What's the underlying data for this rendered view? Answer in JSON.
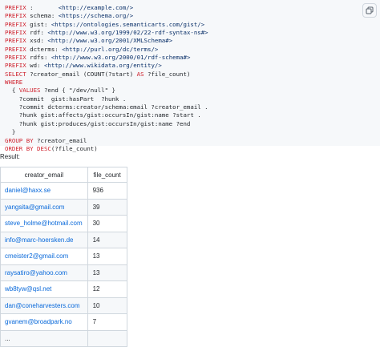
{
  "query": {
    "prefixes": [
      {
        "kw": "PREFIX",
        "name": " :       ",
        "iri": "<http://example.com/>"
      },
      {
        "kw": "PREFIX",
        "name": " schema: ",
        "iri": "<https://schema.org/>"
      },
      {
        "kw": "PREFIX",
        "name": " gist: ",
        "iri": "<https://ontologies.semanticarts.com/gist/>"
      },
      {
        "kw": "PREFIX",
        "name": " rdf: ",
        "iri": "<http://www.w3.org/1999/02/22-rdf-syntax-ns#>"
      },
      {
        "kw": "PREFIX",
        "name": " xsd: ",
        "iri": "<http://www.w3.org/2001/XMLSchema#>"
      },
      {
        "kw": "PREFIX",
        "name": " dcterms: ",
        "iri": "<http://purl.org/dc/terms/>"
      },
      {
        "kw": "PREFIX",
        "name": " rdfs: ",
        "iri": "<http://www.w3.org/2000/01/rdf-schema#>"
      },
      {
        "kw": "PREFIX",
        "name": " wd: ",
        "iri": "<http://www.wikidata.org/entity/>"
      }
    ],
    "select_kw": "SELECT",
    "select_vars": " ?creator_email (COUNT(?start) ",
    "as_kw": "AS",
    "select_alias": " ?file_count)",
    "where_kw": "WHERE",
    "values_open": "  { ",
    "values_kw": "VALUES",
    "values_rest": " ?end { \"/dev/null\" }",
    "triples": [
      "    ?commit  gist:hasPart  ?hunk .",
      "    ?commit dcterms:creator/schema:email ?creator_email .",
      "    ?hunk gist:affects/gist:occursIn/gist:name ?start .",
      "    ?hunk gist:produces/gist:occursIn/gist:name ?end"
    ],
    "close_brace": "  }",
    "group_kw": "GROUP BY",
    "group_var": " ?creator_email",
    "order_kw": "ORDER BY DESC",
    "order_rest": "(?file_count)"
  },
  "result_label": "Result:",
  "table": {
    "headers": [
      "creator_email",
      "file_count"
    ],
    "rows": [
      {
        "email": "daniel@haxx.se",
        "count": "936"
      },
      {
        "email": "yangsita@gmail.com",
        "count": "39"
      },
      {
        "email": "steve_holme@hotmail.com",
        "count": "30"
      },
      {
        "email": "info@marc-hoersken.de",
        "count": "14"
      },
      {
        "email": "cmeister2@gmail.com",
        "count": "13"
      },
      {
        "email": "raysatiro@yahoo.com",
        "count": "13"
      },
      {
        "email": "wb8tyw@qsl.net",
        "count": "12"
      },
      {
        "email": "dan@coneharvesters.com",
        "count": "10"
      },
      {
        "email": "gvanem@broadpark.no",
        "count": "7"
      },
      {
        "email": "...",
        "count": ""
      }
    ]
  },
  "icons": {
    "copy": "copy-icon"
  }
}
